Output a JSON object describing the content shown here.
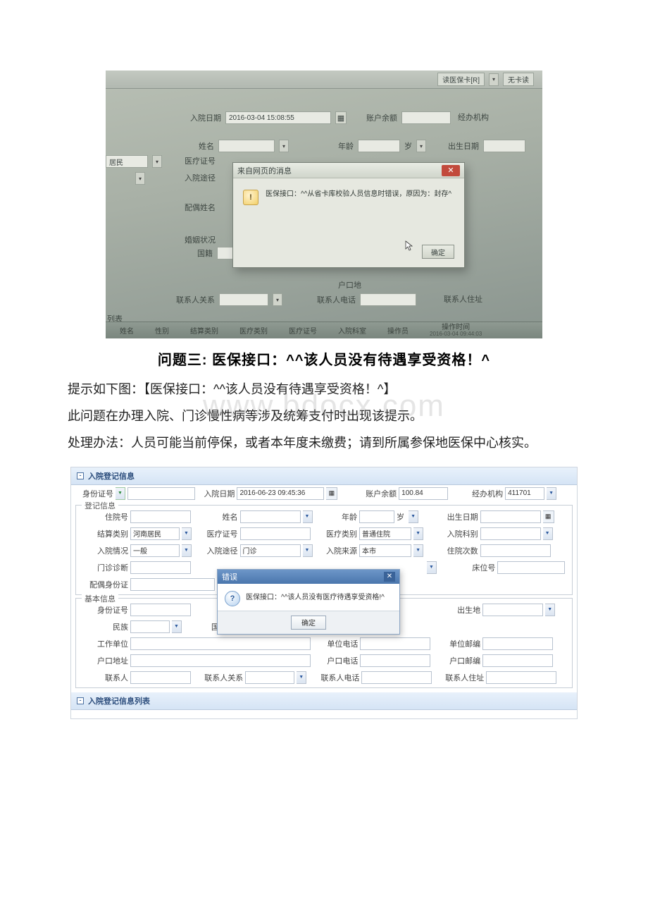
{
  "doc": {
    "heading": "问题三: 医保接口：^^该人员没有待遇享受资格！^",
    "para1": "提示如下图：【医保接口：^^该人员没有待遇享受资格！^】",
    "para2": "此问题在办理入院、门诊慢性病等涉及统筹支付时出现该提示。",
    "para3": "处理办法：人员可能当前停保，或者本年度未缴费；请到所属参保地医保中心核实。",
    "watermark": "www.bdocx.com"
  },
  "photo1": {
    "topbar_chip": "读医保卡[R]",
    "topbar_chip2": "无卡读",
    "admit_date_label": "入院日期",
    "admit_date_value": "2016-03-04 15:08:55",
    "balance_label": "账户余额",
    "agency_label": "经办机构",
    "name_label": "姓名",
    "age_label": "年龄",
    "age_unit": "岁",
    "dob_label": "出生日期",
    "resident_value": "居民",
    "ins_no_label": "医疗证号",
    "route_label": "入院途径",
    "spouse_label": "配偶姓名",
    "marital_label": "婚姻状况",
    "nationality_label": "国籍",
    "hukou_label": "户口地",
    "contact_rel_label": "联系人关系",
    "contact_tel_label": "联系人电话",
    "contact_addr_label": "联系人住址",
    "list_label": "列表",
    "col_name": "姓名",
    "col_sex": "性别",
    "col_settle": "结算类别",
    "col_medtype": "医疗类别",
    "col_insno": "医疗证号",
    "col_dept": "入院科室",
    "col_operator": "操作员",
    "col_optime": "操作时间",
    "col_optime_value": "2016-03-04 09:44:03",
    "dialog": {
      "title": "来自网页的消息",
      "warn_glyph": "!",
      "message": "医保接口：^^从省卡库校验人员信息时错误，原因为：封存^",
      "ok": "确定"
    }
  },
  "shot2": {
    "panel1_title": "入院登记信息",
    "panel2_title": "入院登记信息列表",
    "id_type_label": "身份证号",
    "admit_date_label": "入院日期",
    "admit_date_value": "2016-06-23 09:45:36",
    "balance_label": "账户余额",
    "balance_value": "100.84",
    "agency_label": "经办机构",
    "agency_value": "411701",
    "reg_legend": "登记信息",
    "basic_legend": "基本信息",
    "hosp_no_label": "住院号",
    "name_label": "姓名",
    "age_label": "年龄",
    "age_unit": "岁",
    "dob_label": "出生日期",
    "settle_label": "结算类别",
    "settle_value": "河南居民",
    "ins_no_label": "医疗证号",
    "med_type_label": "医疗类别",
    "med_type_value": "普通住院",
    "dept_label": "入院科别",
    "status_label": "入院情况",
    "status_value": "一般",
    "route_label": "入院途径",
    "route_value": "门诊",
    "source_label": "入院来源",
    "source_value": "本市",
    "times_label": "住院次数",
    "diag_label": "门诊诊断",
    "bed_label": "床位号",
    "spouse_id_label": "配偶身份证",
    "basic_id_label": "身份证号",
    "birthplace_label": "出生地",
    "ethnic_label": "民族",
    "nationality_label": "国籍",
    "employer_label": "工作单位",
    "employer_tel_label": "单位电话",
    "employer_zip_label": "单位邮编",
    "hukou_addr_label": "户口地址",
    "hukou_tel_label": "户口电话",
    "hukou_zip_label": "户口邮编",
    "contact_label": "联系人",
    "contact_rel_label": "联系人关系",
    "contact_tel_label": "联系人电话",
    "contact_addr_label": "联系人住址",
    "dialog": {
      "title": "错误",
      "q_glyph": "?",
      "message": "医保接口：^^该人员没有医疗待遇享受资格!^",
      "ok": "确定"
    }
  }
}
